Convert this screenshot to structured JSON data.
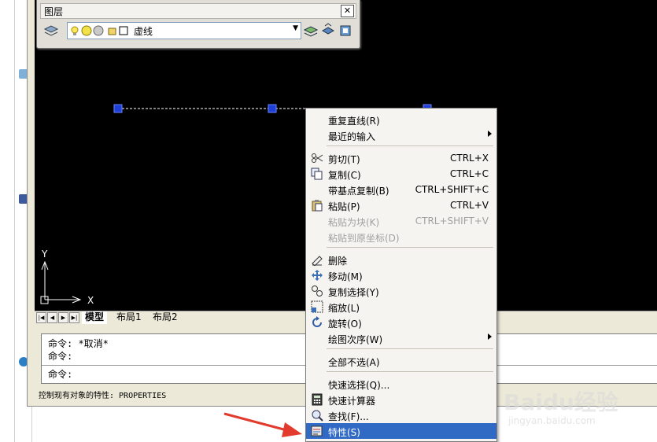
{
  "layer_toolbar": {
    "title": "图层",
    "close_glyph": "✕",
    "current_layer": "虚线"
  },
  "viewport": {
    "axis_y": "Y",
    "axis_x": "X"
  },
  "tabs": {
    "items": [
      {
        "label": "模型",
        "active": true
      },
      {
        "label": "布局1",
        "active": false
      },
      {
        "label": "布局2",
        "active": false
      }
    ]
  },
  "command_line": {
    "lines": [
      "命令: *取消*",
      "命令:",
      "命令:"
    ]
  },
  "status_bar": {
    "text": "控制现有对象的特性:  PROPERTIES"
  },
  "context_menu": {
    "items": [
      {
        "label": "重复直线(R)",
        "shortcut": "",
        "icon": "",
        "submenu": false,
        "disabled": false
      },
      {
        "label": "最近的输入",
        "shortcut": "",
        "icon": "",
        "submenu": true,
        "disabled": false
      },
      {
        "label": "剪切(T)",
        "shortcut": "CTRL+X",
        "icon": "scissors-icon",
        "submenu": false,
        "disabled": false
      },
      {
        "label": "复制(C)",
        "shortcut": "CTRL+C",
        "icon": "copy-icon",
        "submenu": false,
        "disabled": false
      },
      {
        "label": "带基点复制(B)",
        "shortcut": "CTRL+SHIFT+C",
        "icon": "",
        "submenu": false,
        "disabled": false
      },
      {
        "label": "粘贴(P)",
        "shortcut": "CTRL+V",
        "icon": "paste-icon",
        "submenu": false,
        "disabled": false
      },
      {
        "label": "粘贴为块(K)",
        "shortcut": "CTRL+SHIFT+V",
        "icon": "",
        "submenu": false,
        "disabled": true
      },
      {
        "label": "粘贴到原坐标(D)",
        "shortcut": "",
        "icon": "",
        "submenu": false,
        "disabled": true
      },
      {
        "label": "删除",
        "shortcut": "",
        "icon": "eraser-icon",
        "submenu": false,
        "disabled": false
      },
      {
        "label": "移动(M)",
        "shortcut": "",
        "icon": "move-icon",
        "submenu": false,
        "disabled": false
      },
      {
        "label": "复制选择(Y)",
        "shortcut": "",
        "icon": "copy-selection-icon",
        "submenu": false,
        "disabled": false
      },
      {
        "label": "缩放(L)",
        "shortcut": "",
        "icon": "scale-icon",
        "submenu": false,
        "disabled": false
      },
      {
        "label": "旋转(O)",
        "shortcut": "",
        "icon": "rotate-icon",
        "submenu": false,
        "disabled": false
      },
      {
        "label": "绘图次序(W)",
        "shortcut": "",
        "icon": "",
        "submenu": true,
        "disabled": false
      },
      {
        "label": "全部不选(A)",
        "shortcut": "",
        "icon": "",
        "submenu": false,
        "disabled": false
      },
      {
        "label": "快速选择(Q)...",
        "shortcut": "",
        "icon": "",
        "submenu": false,
        "disabled": false
      },
      {
        "label": "快速计算器",
        "shortcut": "",
        "icon": "calculator-icon",
        "submenu": false,
        "disabled": false
      },
      {
        "label": "查找(F)...",
        "shortcut": "",
        "icon": "find-icon",
        "submenu": false,
        "disabled": false
      },
      {
        "label": "特性(S)",
        "shortcut": "",
        "icon": "properties-icon",
        "submenu": false,
        "disabled": false,
        "highlighted": true
      }
    ]
  },
  "watermark": {
    "brand": "Baidu经验",
    "url": "jingyan.baidu.com"
  },
  "colors": {
    "canvas": "#000000",
    "highlight": "#316ac5",
    "grip": "#1f3fd9",
    "arrow": "#e23a2c"
  }
}
